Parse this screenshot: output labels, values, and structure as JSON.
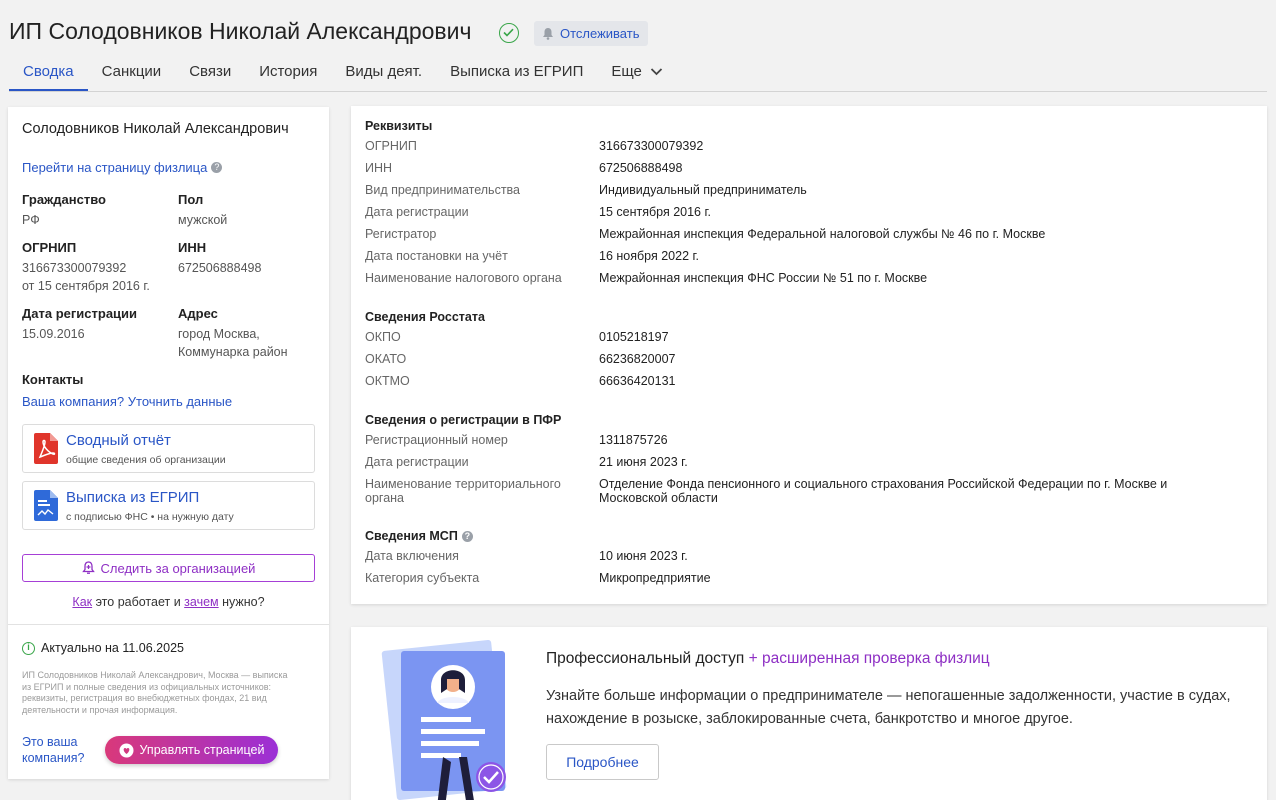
{
  "header": {
    "title": "ИП Солодовников Николай Александрович",
    "track_label": "Отслеживать",
    "tabs": [
      {
        "label": "Сводка",
        "active": true
      },
      {
        "label": "Санкции"
      },
      {
        "label": "Связи"
      },
      {
        "label": "История"
      },
      {
        "label": "Виды деят."
      },
      {
        "label": "Выписка из ЕГРИП"
      },
      {
        "label": "Еще"
      }
    ]
  },
  "left": {
    "name": "Солодовников Николай Александрович",
    "person_link": "Перейти на страницу физлица",
    "citizenship_label": "Гражданство",
    "citizenship_value": "РФ",
    "gender_label": "Пол",
    "gender_value": "мужской",
    "ogrnip_label": "ОГРНИП",
    "ogrnip_value": "316673300079392",
    "ogrnip_date": "от 15 сентября 2016 г.",
    "inn_label": "ИНН",
    "inn_value": "672506888498",
    "regdate_label": "Дата регистрации",
    "regdate_value": "15.09.2016",
    "address_label": "Адрес",
    "address_line1": "город Москва,",
    "address_line2": "Коммунарка район",
    "contacts_label": "Контакты",
    "contacts_link": "Ваша компания? Уточнить данные",
    "report_title": "Сводный отчёт",
    "report_sub": "общие сведения об организации",
    "egrip_title": "Выписка из ЕГРИП",
    "egrip_sub": "с подписью ФНС • на нужную дату",
    "follow_label": "Следить за организацией",
    "how_part1": "Как",
    "how_part2": " это работает и ",
    "how_part3": "зачем",
    "how_part4": " нужно?",
    "actual_label": "Актуально на 11.06.2025",
    "description": "ИП Солодовников Николай Александрович, Москва — выписка из ЕГРИП и полные сведения из официальных источников: реквизиты, регистрация во внебюджетных фондах, 21 вид деятельности и прочая информация.",
    "your_company": "Это ваша компания?",
    "manage_label": "Управлять страницей"
  },
  "details": {
    "sections": [
      {
        "title": "Реквизиты",
        "rows": [
          {
            "k": "ОГРНИП",
            "v": "316673300079392"
          },
          {
            "k": "ИНН",
            "v": "672506888498"
          },
          {
            "k": "Вид предпринимательства",
            "v": "Индивидуальный предприниматель"
          },
          {
            "k": "Дата регистрации",
            "v": "15 сентября 2016 г."
          },
          {
            "k": "Регистратор",
            "v": "Межрайонная инспекция Федеральной налоговой службы № 46 по г. Москве"
          },
          {
            "k": "Дата постановки на учёт",
            "v": "16 ноября 2022 г."
          },
          {
            "k": "Наименование налогового органа",
            "v": "Межрайонная инспекция ФНС России № 51 по г. Москве"
          }
        ]
      },
      {
        "title": "Сведения Росстата",
        "rows": [
          {
            "k": "ОКПО",
            "v": "0105218197"
          },
          {
            "k": "ОКАТО",
            "v": "66236820007"
          },
          {
            "k": "ОКТМО",
            "v": "66636420131"
          }
        ]
      },
      {
        "title": "Сведения о регистрации в ПФР",
        "rows": [
          {
            "k": "Регистрационный номер",
            "v": "1311875726"
          },
          {
            "k": "Дата регистрации",
            "v": "21 июня 2023 г."
          },
          {
            "k": "Наименование территориального органа",
            "v": "Отделение Фонда пенсионного и социального страхования Российской Федерации по г. Москве и Московской области"
          }
        ]
      },
      {
        "title": "Сведения МСП",
        "rows": [
          {
            "k": "Дата включения",
            "v": "10 июня 2023 г."
          },
          {
            "k": "Категория субъекта",
            "v": "Микропредприятие"
          }
        ]
      }
    ]
  },
  "promo": {
    "title_main": "Профессиональный доступ",
    "title_accent": " + расширенная проверка физлиц",
    "text": "Узнайте больше информации о предпринимателе — непогашенные задолженности, участие в судах, нахождение в розыске, заблокированные счета, банкротство и многое другое.",
    "button_label": "Подробнее"
  },
  "colors": {
    "accent": "#2a56c6",
    "purple": "#8e2fc4",
    "green": "#3aa64a"
  }
}
